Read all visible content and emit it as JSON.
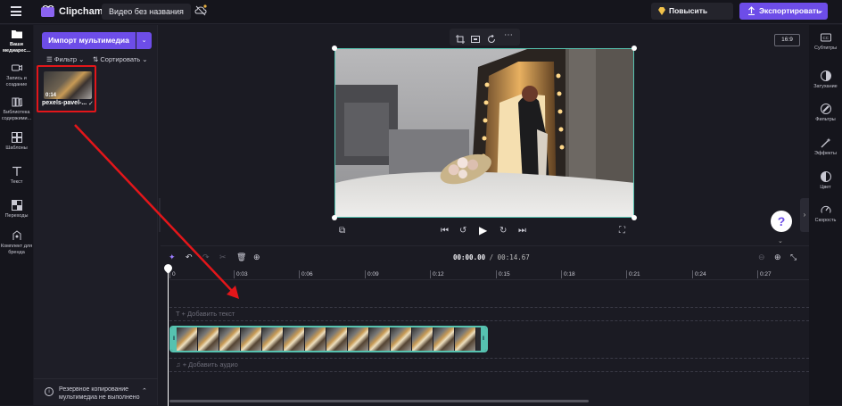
{
  "header": {
    "brand": "Clipchamp",
    "video_title": "Видео без названия",
    "upgrade_label": "Повысить статус",
    "export_label": "Экспортировать"
  },
  "leftnav": {
    "items": [
      {
        "label": "Ваши медиарес...",
        "icon": "folder-icon"
      },
      {
        "label": "Запись и создание",
        "icon": "camera-icon"
      },
      {
        "label": "Библиотека содержими...",
        "icon": "library-icon"
      },
      {
        "label": "Шаблоны",
        "icon": "templates-icon"
      },
      {
        "label": "Текст",
        "icon": "text-icon"
      },
      {
        "label": "Переходы",
        "icon": "transitions-icon"
      },
      {
        "label": "Комплект для бренда",
        "icon": "brand-kit-icon"
      }
    ]
  },
  "media": {
    "import_label": "Импорт мультимедиа",
    "filter_label": "Фильтр",
    "sort_label": "Сортировать",
    "items": [
      {
        "name": "pexels-pavel-...",
        "duration": "0:14"
      }
    ],
    "backup_text": "Резервное копирование мультимедиа не выполнено"
  },
  "preview": {
    "aspect_ratio": "16:9"
  },
  "rightbar": {
    "items": [
      {
        "label": "Субтитры",
        "icon": "captions-icon"
      },
      {
        "label": "Затухание",
        "icon": "fade-icon"
      },
      {
        "label": "Фильтры",
        "icon": "filters-icon"
      },
      {
        "label": "Эффекты",
        "icon": "effects-icon"
      },
      {
        "label": "Цвет",
        "icon": "color-icon"
      },
      {
        "label": "Скорость",
        "icon": "speed-icon"
      }
    ]
  },
  "timeline": {
    "current_time": "00:00.00",
    "total_time": "/ 00:14.67",
    "ruler_ticks": [
      "0",
      "0:03",
      "0:06",
      "0:09",
      "0:12",
      "0:15",
      "0:18",
      "0:21",
      "0:24",
      "0:27"
    ],
    "add_text_label": "+ Добавить текст",
    "add_audio_label": "+ Добавить аудио"
  },
  "colors": {
    "accent": "#6d4de8",
    "clip_border": "#56c2b0",
    "annotation_red": "#e3161a"
  }
}
